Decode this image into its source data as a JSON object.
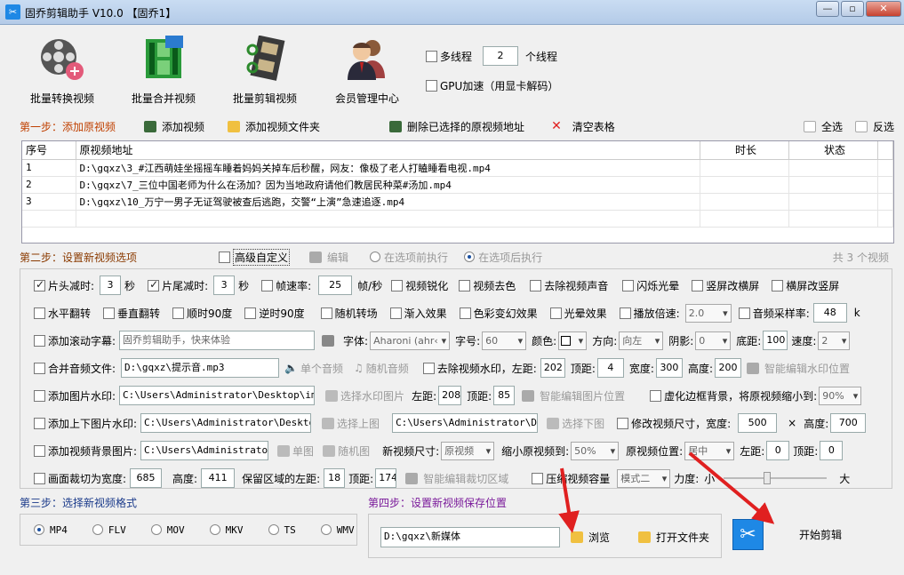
{
  "window": {
    "title": "固乔剪辑助手 V10.0  【固乔1】",
    "app_icon": "scissors-icon",
    "btn_minimize": "—",
    "btn_maximize": "▫",
    "btn_close": "✕"
  },
  "toolbar": [
    {
      "label": "批量转换视频",
      "icon": "film-reel-icon"
    },
    {
      "label": "批量合并视频",
      "icon": "film-strip-icon"
    },
    {
      "label": "批量剪辑视频",
      "icon": "film-cut-icon"
    },
    {
      "label": "会员管理中心",
      "icon": "member-icon"
    }
  ],
  "threads": {
    "label": "多线程",
    "checked": false,
    "value": "2",
    "unit": "个线程"
  },
  "gpu": {
    "label": "GPU加速（用显卡解码）",
    "checked": false
  },
  "step1": {
    "title": "第一步：添加原视频",
    "add_video": "添加视频",
    "add_folder": "添加视频文件夹",
    "delete_selected": "删除已选择的原视频地址",
    "clear_table": "清空表格",
    "select_all": "全选",
    "invert": "反选"
  },
  "table": {
    "headers": [
      "序号",
      "原视频地址",
      "时长",
      "状态"
    ],
    "rows": [
      {
        "no": "1",
        "path": "D:\\gqxz\\3_#江西萌娃坐摇摇车睡着妈妈关掉车后秒醒，网友：像极了老人打瞌睡看电视.mp4",
        "duration": "",
        "status": ""
      },
      {
        "no": "2",
        "path": "D:\\gqxz\\7_三位中国老师为什么在汤加？因为当地政府请他们教居民种菜#汤加.mp4",
        "duration": "",
        "status": ""
      },
      {
        "no": "3",
        "path": "D:\\gqxz\\10_万宁一男子无证驾驶被查后逃跑，交警“上演”急速追逐.mp4",
        "duration": "",
        "status": ""
      }
    ]
  },
  "step2": {
    "title": "第二步：设置新视频选项",
    "advanced": "高级自定义",
    "edit": "编辑",
    "before": "在选项前执行",
    "after": "在选项后执行",
    "count": "共 3 个视频"
  },
  "opts": {
    "head_cut": {
      "label": "片头减时:",
      "checked": true,
      "value": "3",
      "unit": "秒"
    },
    "tail_cut": {
      "label": "片尾减时:",
      "checked": true,
      "value": "3",
      "unit": "秒"
    },
    "fps": {
      "label": "帧速率:",
      "value": "25",
      "unit": "帧/秒"
    },
    "sharpen": "视频锐化",
    "decolor": "视频去色",
    "mute": "去除视频声音",
    "flash": "闪烁光晕",
    "v2h": "竖屏改横屏",
    "h2v": "横屏改竖屏",
    "hflip": "水平翻转",
    "vflip": "垂直翻转",
    "rot90": "顺时90度",
    "rotm90": "逆时90度",
    "rand_trans": "随机转场",
    "fade_in": "渐入效果",
    "color_shift": "色彩变幻效果",
    "halo": "光晕效果",
    "speed": {
      "label": "播放倍速:",
      "value": "2.0"
    },
    "sample": {
      "label": "音频采样率:",
      "value": "48",
      "unit": "k"
    },
    "subtitle": {
      "label": "添加滚动字幕:",
      "value": "固乔剪辑助手，快来体验",
      "font_label": "字体:",
      "font": "Aharoni (ahr‹",
      "size_label": "字号:",
      "size": "60",
      "color_label": "颜色:",
      "dir_label": "方向:",
      "dir": "向左",
      "shadow_label": "阴影:",
      "shadow": "0",
      "bottom_label": "底距:",
      "bottom": "100",
      "speed_label": "速度:",
      "speed": "2"
    },
    "audio": {
      "label": "合并音频文件:",
      "value": "D:\\gqxz\\提示音.mp3",
      "single": "单个音频",
      "random": "随机音频"
    },
    "watermark": {
      "label": "去除视频水印，左距:",
      "left": "202",
      "top_label": "顶距:",
      "top": "4",
      "w_label": "宽度:",
      "w": "300",
      "h_label": "高度:",
      "h": "200",
      "smart": "智能编辑水印位置"
    },
    "img_wm": {
      "label": "添加图片水印:",
      "value": "C:\\Users\\Administrator\\Desktop\\img-q",
      "choose": "选择水印图片",
      "left_label": "左距:",
      "left": "208",
      "top_label": "顶距:",
      "top": "85",
      "smart": "智能编辑图片位置"
    },
    "blur_bg": {
      "label": "虚化边框背景，将原视频缩小到:",
      "value": "90%"
    },
    "updown": {
      "label": "添加上下图片水印:",
      "up": "C:\\Users\\Administrator\\Desktop\\i",
      "choose_up": "选择上图",
      "down": "C:\\Users\\Administrator\\Deskt",
      "choose_down": "选择下图"
    },
    "resize": {
      "label": "修改视频尺寸，宽度:",
      "w": "500",
      "x": "×",
      "h_label": "高度:",
      "h": "700"
    },
    "bgimg": {
      "label": "添加视频背景图片:",
      "value": "C:\\Users\\Administrator\\D",
      "single": "单图",
      "random": "随机图",
      "size_label": "新视频尺寸:",
      "size": "原视频",
      "shrink_label": "缩小原视频到:",
      "shrink": "50%",
      "pos_label": "原视频位置:",
      "pos": "居中",
      "left_label": "左距:",
      "left": "0",
      "top_label": "顶距:",
      "top": "0"
    },
    "crop": {
      "label": "画面裁切为宽度:",
      "w": "685",
      "h_label": "高度:",
      "h": "411",
      "left_label": "保留区域的左距:",
      "left": "18",
      "top_label": "顶距:",
      "top": "174",
      "smart": "智能编辑裁切区域"
    },
    "compress": {
      "label": "压缩视频容量",
      "mode": "模式二",
      "force_label": "力度:",
      "small": "小",
      "large": "大",
      "level": 0.42
    }
  },
  "step3": {
    "title": "第三步：选择新视频格式",
    "formats": [
      "MP4",
      "FLV",
      "MOV",
      "MKV",
      "TS",
      "WMV"
    ],
    "selected": "MP4"
  },
  "step4": {
    "title": "第四步：设置新视频保存位置",
    "path": "D:\\gqxz\\新媒体",
    "browse": "浏览",
    "open": "打开文件夹"
  },
  "start": {
    "label": "开始剪辑",
    "icon": "scissors-icon"
  },
  "colors": {
    "accent": "#1e88e5",
    "annotation": "#e02020"
  }
}
